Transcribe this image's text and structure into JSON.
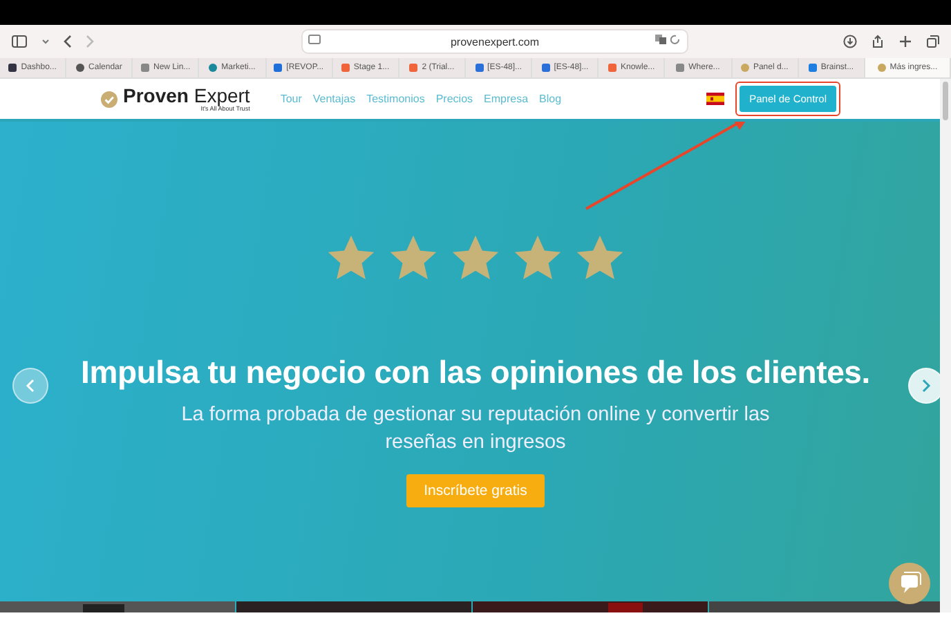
{
  "browser": {
    "url": "provenexpert.com",
    "tabs": [
      {
        "label": "Dashbo...",
        "selected": false
      },
      {
        "label": "Calendar",
        "selected": false
      },
      {
        "label": "New Lin...",
        "selected": false
      },
      {
        "label": "Marketi...",
        "selected": false
      },
      {
        "label": "[REVOP...",
        "selected": false
      },
      {
        "label": "Stage 1...",
        "selected": false
      },
      {
        "label": "2 (Trial...",
        "selected": false
      },
      {
        "label": "[ES-48]...",
        "selected": false
      },
      {
        "label": "[ES-48]...",
        "selected": false
      },
      {
        "label": "Knowle...",
        "selected": false
      },
      {
        "label": "Where...",
        "selected": false
      },
      {
        "label": "Panel d...",
        "selected": false
      },
      {
        "label": "Brainst...",
        "selected": false
      },
      {
        "label": "Más ingres...",
        "selected": true
      }
    ]
  },
  "site": {
    "logo": {
      "brand_bold": "Proven",
      "brand_light": "Expert",
      "tagline": "It's All About Trust"
    },
    "nav": [
      "Tour",
      "Ventajas",
      "Testimonios",
      "Precios",
      "Empresa",
      "Blog"
    ],
    "cta": "Panel de Control"
  },
  "hero": {
    "stars": 5,
    "headline": "Impulsa tu negocio con las opiniones de los clientes.",
    "subtitle": "La forma probada de gestionar su reputación online y convertir las reseñas en ingresos",
    "button": "Inscríbete gratis"
  }
}
